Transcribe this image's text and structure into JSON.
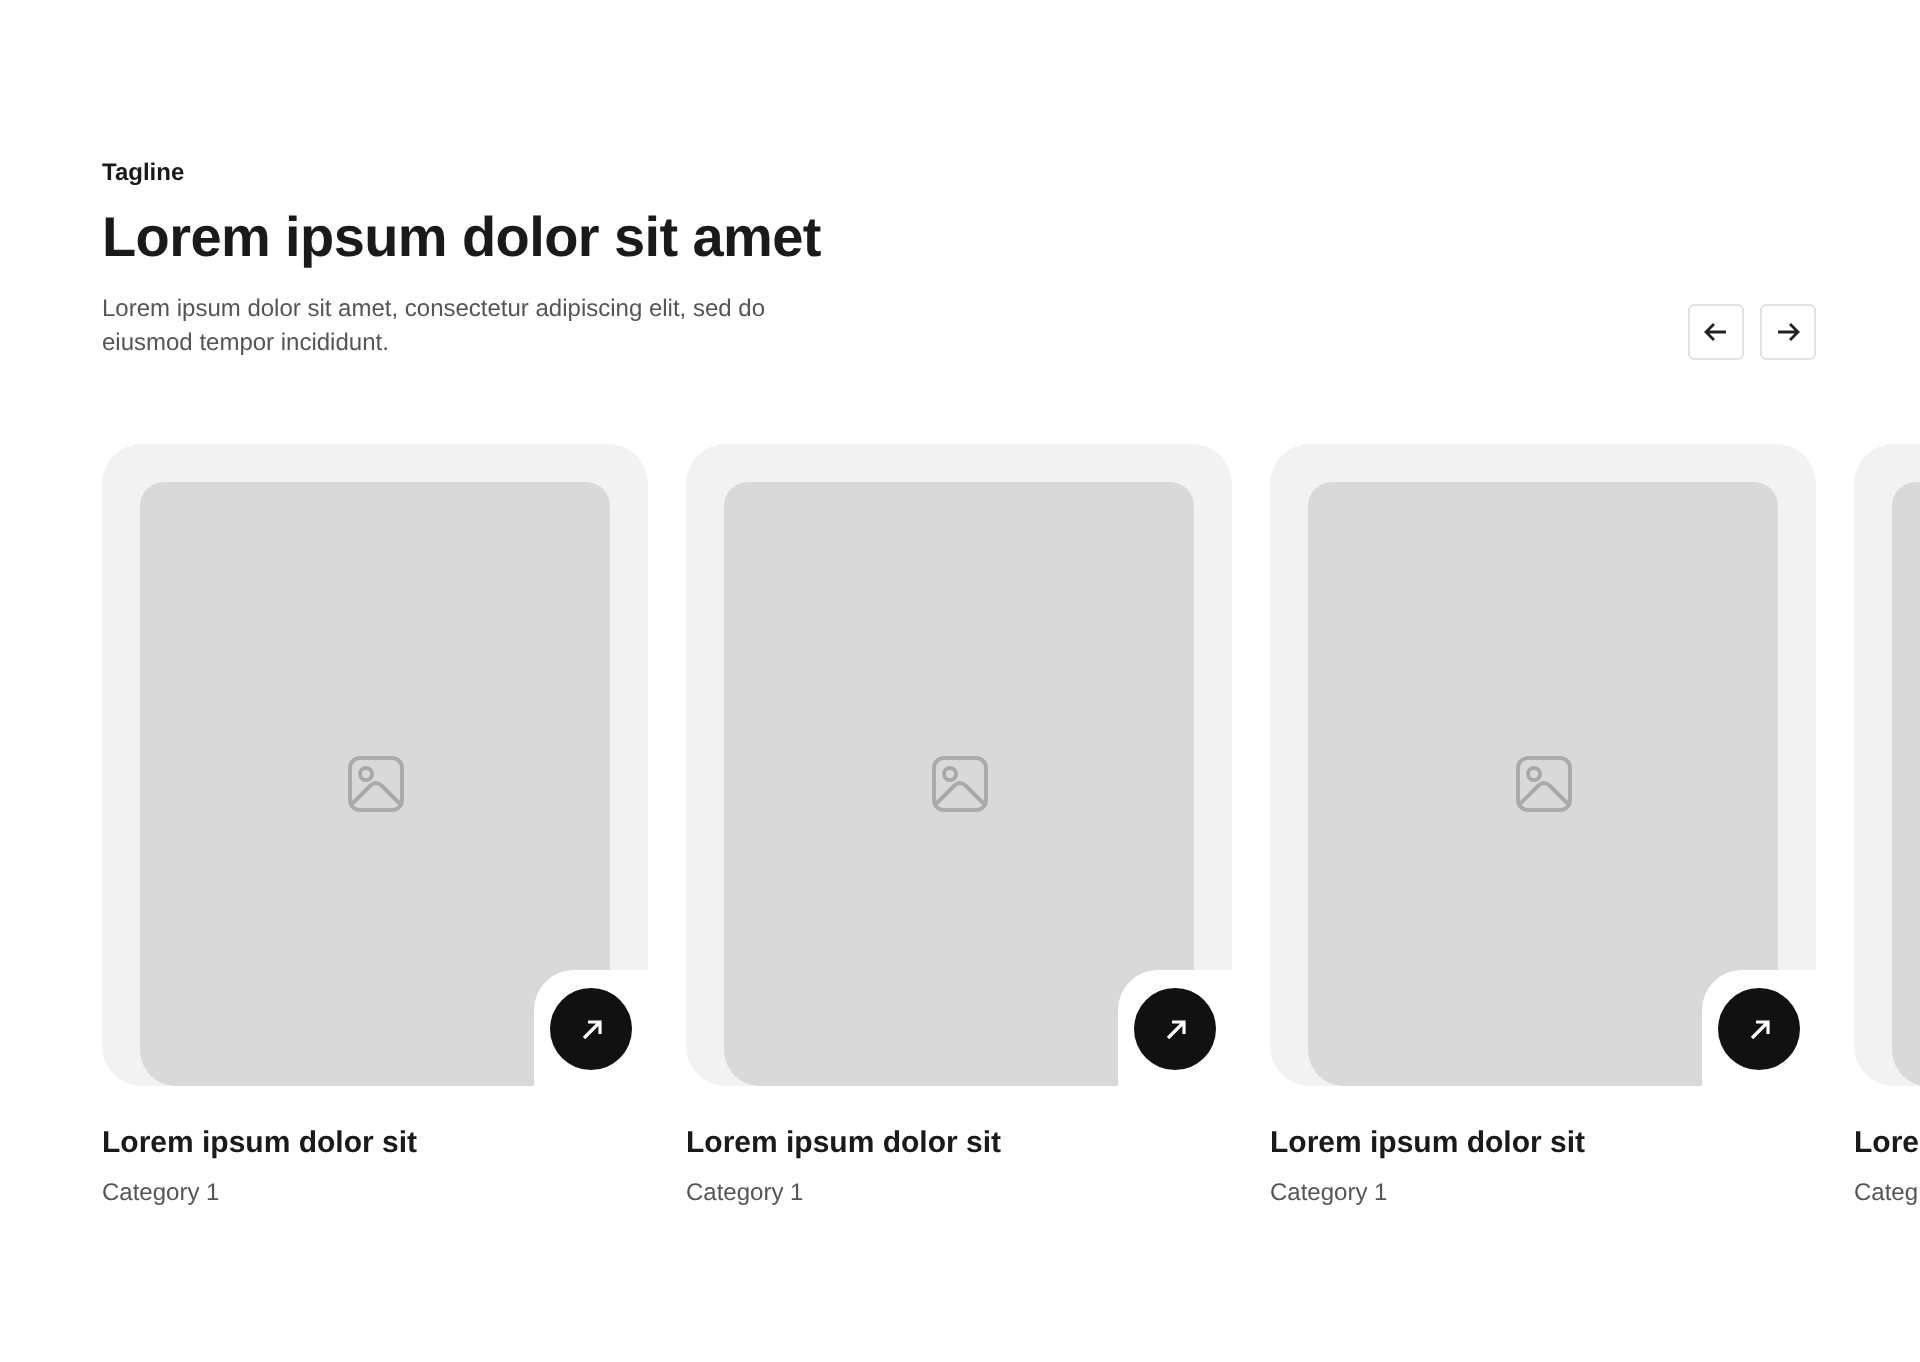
{
  "header": {
    "tagline": "Tagline",
    "title": "Lorem ipsum dolor sit amet",
    "description": "Lorem ipsum dolor sit amet, consectetur adipiscing elit, sed do eiusmod tempor incididunt."
  },
  "nav_buttons": [
    {
      "kind": "previous"
    },
    {
      "kind": "next"
    }
  ],
  "cards": [
    {
      "kind": "full",
      "title": "Lorem ipsum dolor sit",
      "category": "Category 1"
    },
    {
      "kind": "full",
      "title": "Lorem ipsum dolor sit",
      "category": "Category 1"
    },
    {
      "kind": "full",
      "title": "Lorem ipsum dolor sit",
      "category": "Category 1"
    },
    {
      "kind": "partial",
      "title": "Lore",
      "category": "Categ"
    }
  ]
}
